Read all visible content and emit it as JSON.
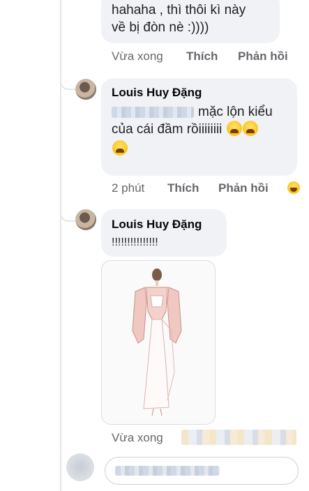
{
  "comments": [
    {
      "text_line1": "hahaha , thì thôi kì này",
      "text_line2": "về bị đòn nè :))))",
      "actions": {
        "time": "Vừa xong",
        "like": "Thích",
        "reply": "Phản hồi"
      }
    },
    {
      "author": "Louis Huy Đặng",
      "text_line1": "mặc lộn kiểu",
      "text_line2": "của cái đầm rồiiiiiiii",
      "emoji": "weary-face-emoji",
      "actions": {
        "time": "2 phút",
        "like": "Thích",
        "reply": "Phản hồi"
      },
      "reaction_emoji": "laughing-face-emoji"
    },
    {
      "author": "Louis Huy Đặng",
      "text": "!!!!!!!!!!!!!!!",
      "attachment": "fashion-sketch-image",
      "actions": {
        "time": "Vừa xong"
      }
    }
  ],
  "colors": {
    "bubble": "#f0f2f5",
    "secondary_text": "#65676b",
    "thread_line": "#e4e6eb"
  }
}
